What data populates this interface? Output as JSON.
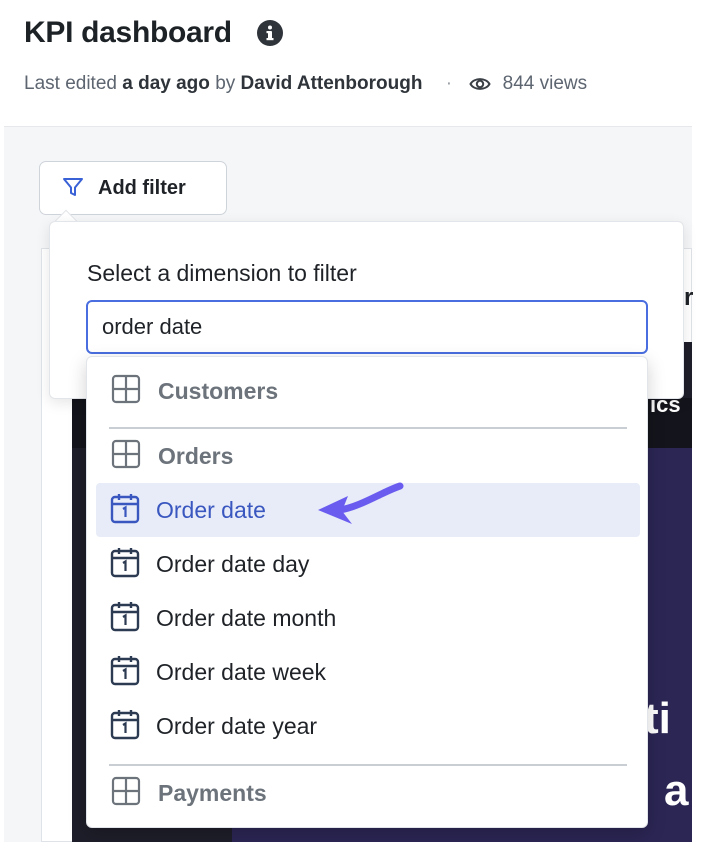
{
  "header": {
    "title": "KPI dashboard",
    "info_icon": "info-circle-icon",
    "meta_prefix": "Last edited",
    "meta_when": "a day ago",
    "meta_by": "by",
    "meta_author": "David Attenborough",
    "meta_separator": "·",
    "views": "844 views"
  },
  "toolbar": {
    "add_filter_label": "Add filter",
    "filter_icon": "funnel-icon"
  },
  "background_fragments": {
    "card_title_fragment": "r",
    "dark_label_fragment": "ics",
    "big_text_line1": "ti",
    "big_text_line2": "a"
  },
  "filter_popover": {
    "label": "Select a dimension to filter",
    "search_value": "order date",
    "groups": [
      {
        "label": "Customers",
        "icon": "table-icon"
      },
      {
        "label": "Orders",
        "icon": "table-icon"
      },
      {
        "label": "Payments",
        "icon": "table-icon"
      }
    ],
    "items": [
      {
        "label": "Order date",
        "icon": "calendar-icon",
        "selected": true
      },
      {
        "label": "Order date day",
        "icon": "calendar-icon"
      },
      {
        "label": "Order date month",
        "icon": "calendar-icon"
      },
      {
        "label": "Order date week",
        "icon": "calendar-icon"
      },
      {
        "label": "Order date year",
        "icon": "calendar-icon"
      }
    ]
  },
  "colors": {
    "accent": "#4a6ee0",
    "selected_bg": "#e7ecf8",
    "selected_text": "#3a57c0",
    "annotation_arrow": "#6b5cf0"
  }
}
